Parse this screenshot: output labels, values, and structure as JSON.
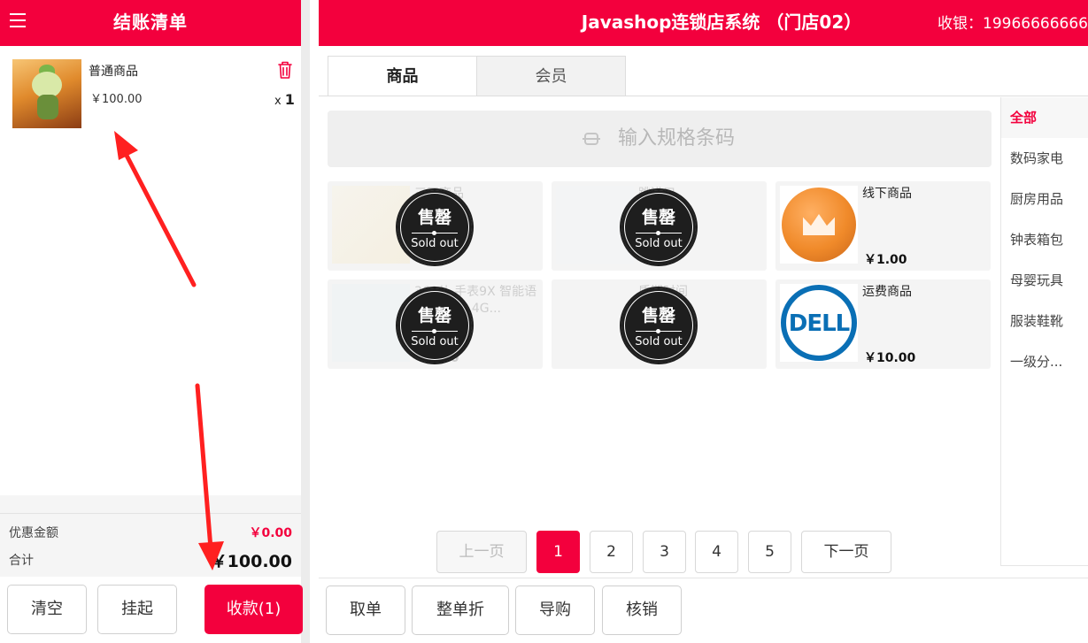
{
  "left": {
    "title": "结账清单",
    "cart_items": [
      {
        "name": "普通商品",
        "price": "￥100.00",
        "qty_prefix": "x",
        "qty": "1"
      }
    ],
    "discount_label": "优惠金额",
    "discount_value": "￥0.00",
    "total_label": "合计",
    "total_value": "￥100.00",
    "buttons": {
      "clear": "清空",
      "hold": "挂起",
      "pay": "收款(1)"
    }
  },
  "header": {
    "title": "Javashop连锁店系统 （门店02）",
    "cashier": "收银：19966666666"
  },
  "tabs": {
    "goods": "商品",
    "member": "会员"
  },
  "barcode": {
    "placeholder": "输入规格条码"
  },
  "soldout_badge": {
    "cn": "售罄",
    "en": "Sold out"
  },
  "products": [
    {
      "name": "三天商品",
      "price": "00",
      "soldout": true
    },
    {
      "name": "跳进口",
      "price": "00",
      "soldout": true
    },
    {
      "name": "线下商品",
      "price": "￥1.00",
      "soldout": false,
      "icon": "crown-coin-icon"
    },
    {
      "name": "360儿 手表9X 智能语音问 手表 4G...",
      "price": "￥0.20",
      "soldout": true
    },
    {
      "name": "质期时间",
      "price": "0",
      "soldout": true
    },
    {
      "name": "运费商品",
      "price": "￥10.00",
      "soldout": false,
      "icon": "dell-logo"
    }
  ],
  "categories": [
    "全部",
    "数码家电",
    "厨房用品",
    "钟表箱包",
    "母婴玩具",
    "服装鞋靴",
    "一级分..."
  ],
  "pagination": {
    "prev": "上一页",
    "pages": [
      "1",
      "2",
      "3",
      "4",
      "5"
    ],
    "active": "1",
    "next": "下一页"
  },
  "actions": [
    "取单",
    "整单折",
    "导购",
    "核销"
  ],
  "colors": {
    "brand_red": "#f3003d",
    "annotation_red": "#ff2020"
  }
}
